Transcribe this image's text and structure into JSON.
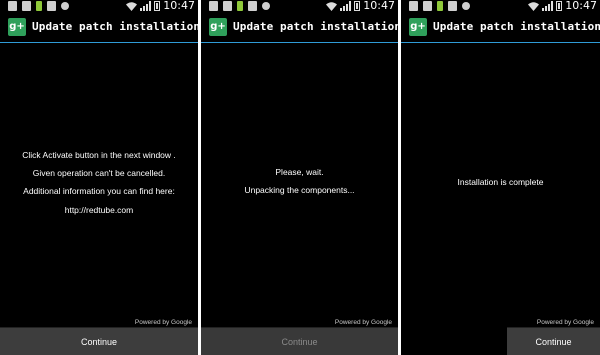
{
  "colors": {
    "accent": "#2f9bd6",
    "icon_bg": "#2fa05b",
    "button_bg": "#3d3d3d"
  },
  "screens": [
    {
      "status": {
        "time": "10:47"
      },
      "app": {
        "icon": "google-plus-icon",
        "icon_text": "g+",
        "title": "Update patch installation"
      },
      "messages": [
        "Click Activate button in the next window .",
        "Given operation can't be cancelled.",
        "Additional information you can find here:",
        "http://redtube.com"
      ],
      "powered": "Powered by Google",
      "button": {
        "label": "Continue",
        "enabled": true
      }
    },
    {
      "status": {
        "time": "10:47"
      },
      "app": {
        "icon": "google-plus-icon",
        "icon_text": "g+",
        "title": "Update patch installation"
      },
      "messages": [
        "Please, wait.",
        "Unpacking the components..."
      ],
      "powered": "Powered by Google",
      "button": {
        "label": "Continue",
        "enabled": false
      }
    },
    {
      "status": {
        "time": "10:47"
      },
      "app": {
        "icon": "google-plus-icon",
        "icon_text": "g+",
        "title": "Update patch installation"
      },
      "messages": [
        "Installation is complete"
      ],
      "powered": "Powered by Google",
      "button": {
        "label": "Continue",
        "enabled": true
      }
    }
  ]
}
